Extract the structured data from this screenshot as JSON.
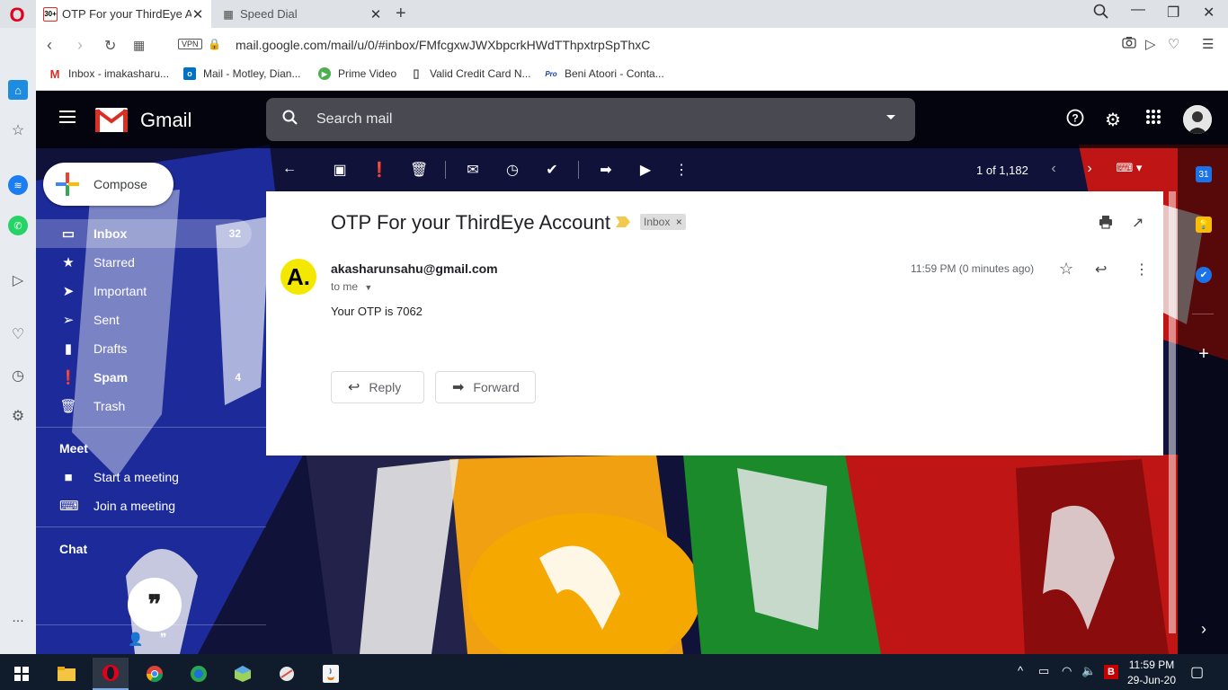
{
  "browser": {
    "tabs": [
      {
        "title": "OTP For your ThirdEye Acco",
        "badge": "30+",
        "active": true
      },
      {
        "title": "Speed Dial",
        "active": false
      }
    ],
    "url": "mail.google.com/mail/u/0/#inbox/FMfcgxwJWXbpcrkHWdTThpxtrpSpThxC",
    "vpn_label": "VPN",
    "bookmarks": [
      {
        "label": "Inbox - imakasharu...",
        "icon": "gmail-icon"
      },
      {
        "label": "Mail - Motley, Dian...",
        "icon": "outlook-icon"
      },
      {
        "label": "Prime Video",
        "icon": "prime-video-icon"
      },
      {
        "label": "Valid Credit Card N...",
        "icon": "page-icon"
      },
      {
        "label": "Beni Atoori - Conta...",
        "icon": "pro-icon"
      }
    ],
    "sidebar_more": "..."
  },
  "gmail": {
    "brand": "Gmail",
    "search_placeholder": "Search mail",
    "compose_label": "Compose",
    "nav": [
      {
        "label": "Inbox",
        "count": "32",
        "icon": "inbox-icon",
        "selected": true
      },
      {
        "label": "Starred",
        "count": "",
        "icon": "star-icon"
      },
      {
        "label": "Important",
        "count": "",
        "icon": "important-icon"
      },
      {
        "label": "Sent",
        "count": "",
        "icon": "send-icon"
      },
      {
        "label": "Drafts",
        "count": "",
        "icon": "draft-icon"
      },
      {
        "label": "Spam",
        "count": "4",
        "icon": "spam-icon"
      },
      {
        "label": "Trash",
        "count": "",
        "icon": "trash-icon"
      }
    ],
    "meet": {
      "heading": "Meet",
      "items": [
        {
          "label": "Start a meeting",
          "icon": "video-icon"
        },
        {
          "label": "Join a meeting",
          "icon": "keyboard-icon"
        }
      ]
    },
    "chat_heading": "Chat",
    "pager": "1 of 1,182",
    "message": {
      "subject": "OTP For your ThirdEye Account",
      "label": "Inbox",
      "label_remove": "×",
      "sender_initial": "A.",
      "sender": "akasharunsahu@gmail.com",
      "to": "to me",
      "time": "11:59 PM (0 minutes ago)",
      "body": "Your OTP is 7062",
      "reply_label": "Reply",
      "forward_label": "Forward"
    },
    "right_panel": {
      "calendar_day": "31"
    }
  },
  "taskbar": {
    "time": "11:59 PM",
    "date": "29-Jun-20"
  },
  "colors": {
    "gmail_red": "#d93025",
    "opera_red": "#e2001a",
    "sender_avatar": "#f5e800",
    "taskbar": "#101c2c"
  }
}
